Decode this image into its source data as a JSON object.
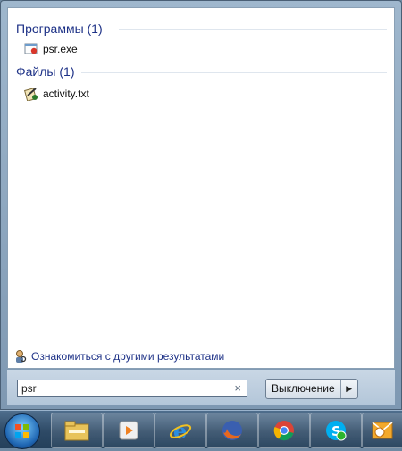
{
  "results": {
    "programs_header": "Программы (1)",
    "programs": [
      {
        "label": "psr.exe",
        "icon": "psr-app-icon"
      }
    ],
    "files_header": "Файлы (1)",
    "files": [
      {
        "label": "activity.txt",
        "icon": "text-file-icon"
      }
    ]
  },
  "more_results_label": "Ознакомиться с другими результатами",
  "search": {
    "value": "psr",
    "clear_glyph": "×"
  },
  "shutdown": {
    "label": "Выключение",
    "arrow": "▶"
  },
  "taskbar": {
    "items": [
      {
        "icon": "windows-start-icon"
      },
      {
        "icon": "file-explorer-icon"
      },
      {
        "icon": "media-player-icon"
      },
      {
        "icon": "internet-explorer-icon"
      },
      {
        "icon": "firefox-icon"
      },
      {
        "icon": "chrome-icon"
      },
      {
        "icon": "skype-icon"
      },
      {
        "icon": "outlook-icon"
      }
    ]
  },
  "colors": {
    "header_text": "#1e3287",
    "taskbar": "#2e4a66"
  }
}
